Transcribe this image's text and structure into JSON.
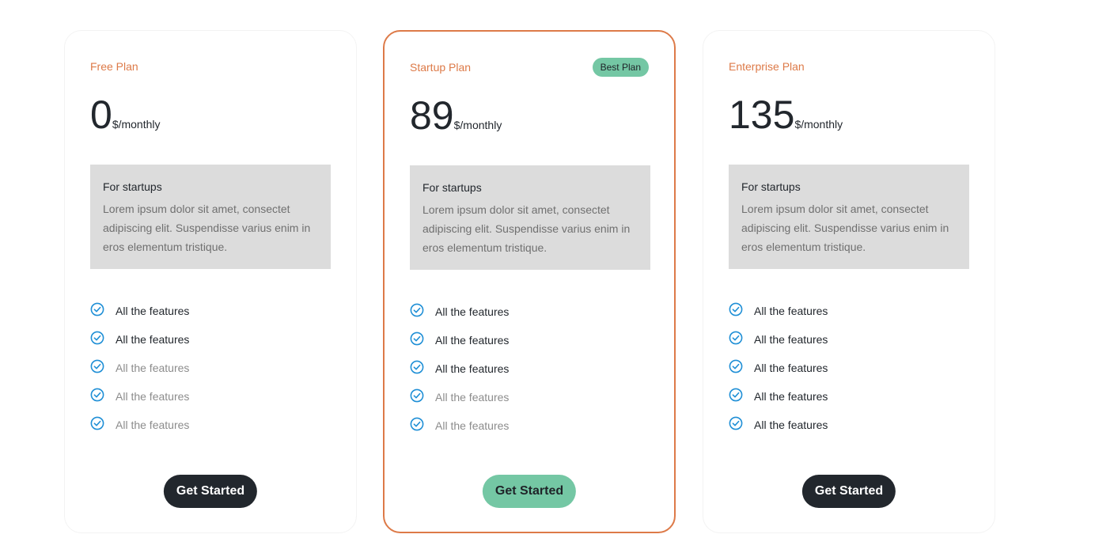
{
  "plans": [
    {
      "name": "Free Plan",
      "badge": "",
      "price": "0",
      "period": "$/monthly",
      "info_title": "For startups",
      "info_desc": "Lorem ipsum dolor sit amet, consectet adipiscing elit. Suspendisse varius enim in eros elementum tristique.",
      "features": [
        {
          "label": "All the features",
          "active": true
        },
        {
          "label": "All the features",
          "active": true
        },
        {
          "label": "All the features",
          "active": false
        },
        {
          "label": "All the features",
          "active": false
        },
        {
          "label": "All the features",
          "active": false
        }
      ],
      "cta": "Get Started"
    },
    {
      "name": "Startup Plan",
      "badge": "Best Plan",
      "price": "89",
      "period": "$/monthly",
      "info_title": "For startups",
      "info_desc": "Lorem ipsum dolor sit amet, consectet adipiscing elit. Suspendisse varius enim in eros elementum tristique.",
      "features": [
        {
          "label": "All the features",
          "active": true
        },
        {
          "label": "All the features",
          "active": true
        },
        {
          "label": "All the features",
          "active": true
        },
        {
          "label": "All the features",
          "active": false
        },
        {
          "label": "All the features",
          "active": false
        }
      ],
      "cta": "Get Started"
    },
    {
      "name": "Enterprise Plan",
      "badge": "",
      "price": "135",
      "period": "$/monthly",
      "info_title": "For startups",
      "info_desc": "Lorem ipsum dolor sit amet, consectet adipiscing elit. Suspendisse varius enim in eros elementum tristique.",
      "features": [
        {
          "label": "All the features",
          "active": true
        },
        {
          "label": "All the features",
          "active": true
        },
        {
          "label": "All the features",
          "active": true
        },
        {
          "label": "All the features",
          "active": true
        },
        {
          "label": "All the features",
          "active": true
        }
      ],
      "cta": "Get Started"
    }
  ],
  "colors": {
    "accent": "#dd7a48",
    "badge_bg": "#74c7a4",
    "button_dark": "#22272d",
    "check": "#1f8fd6",
    "info_bg": "#dcdcdc"
  },
  "icons": {
    "feature": "check-circle-icon"
  }
}
